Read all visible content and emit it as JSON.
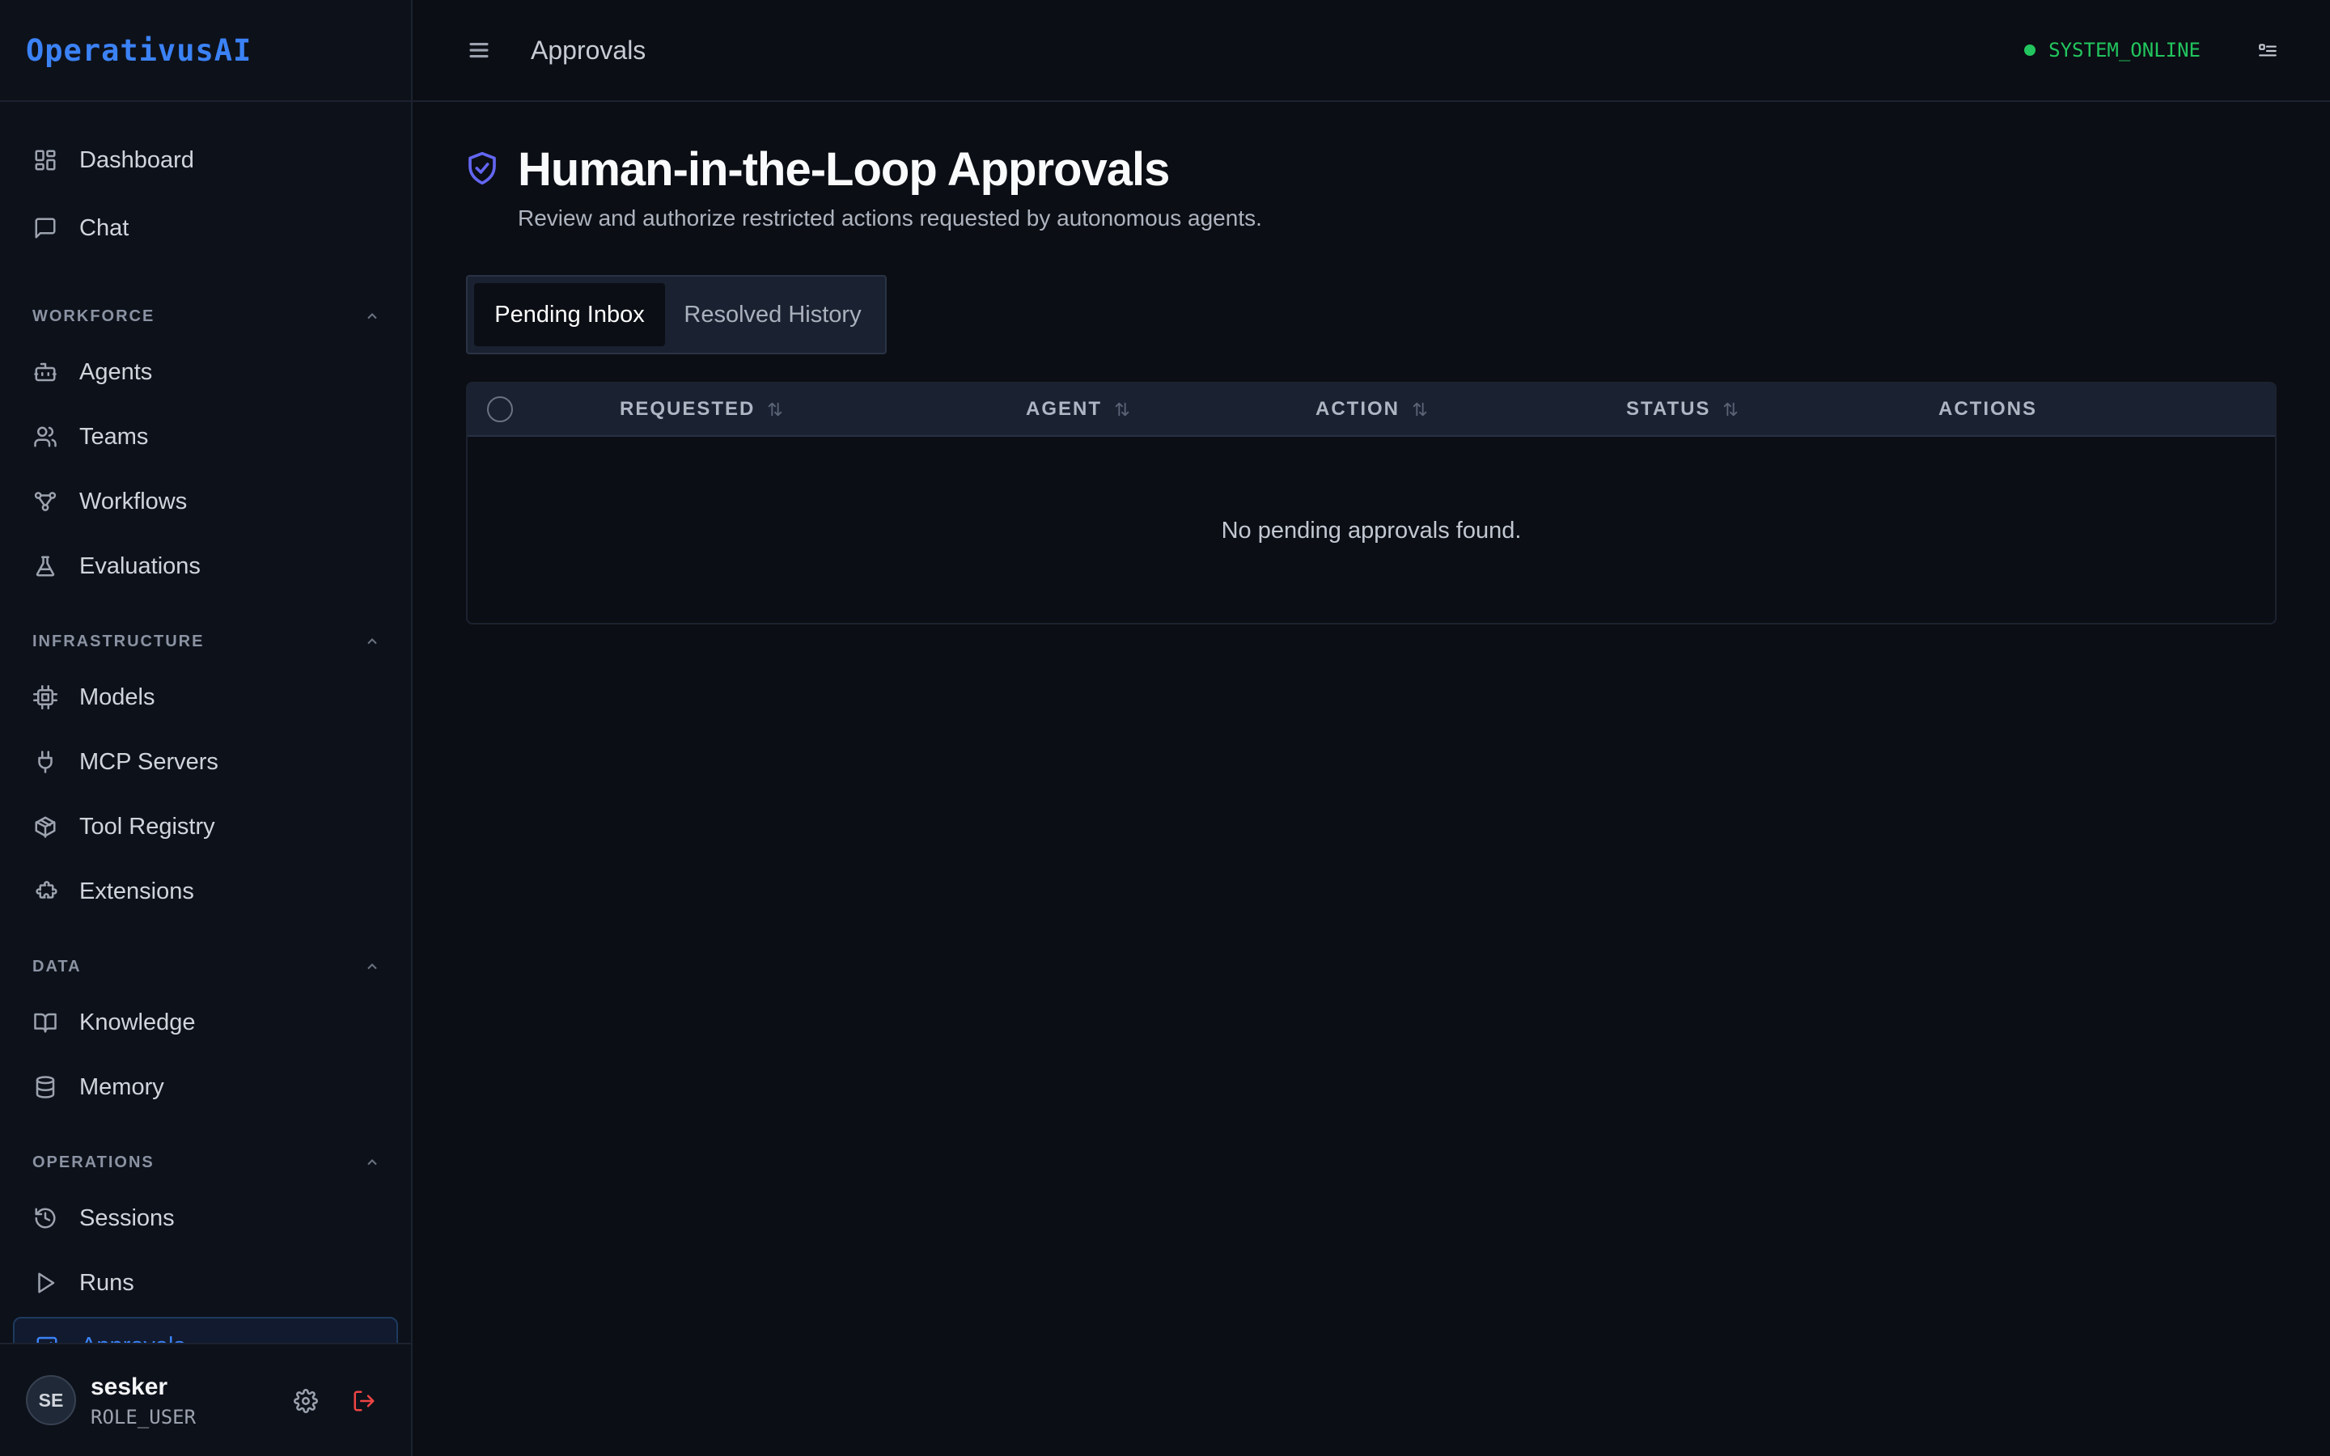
{
  "brand": "OperativusAI",
  "header": {
    "title": "Approvals",
    "status": "SYSTEM_ONLINE"
  },
  "sidebar": {
    "top": [
      {
        "label": "Dashboard"
      },
      {
        "label": "Chat"
      }
    ],
    "sections": [
      {
        "title": "WORKFORCE",
        "items": [
          {
            "label": "Agents"
          },
          {
            "label": "Teams"
          },
          {
            "label": "Workflows"
          },
          {
            "label": "Evaluations"
          }
        ]
      },
      {
        "title": "INFRASTRUCTURE",
        "items": [
          {
            "label": "Models"
          },
          {
            "label": "MCP Servers"
          },
          {
            "label": "Tool Registry"
          },
          {
            "label": "Extensions"
          }
        ]
      },
      {
        "title": "DATA",
        "items": [
          {
            "label": "Knowledge"
          },
          {
            "label": "Memory"
          }
        ]
      },
      {
        "title": "OPERATIONS",
        "items": [
          {
            "label": "Sessions"
          },
          {
            "label": "Runs"
          },
          {
            "label": "Approvals",
            "active": true
          }
        ]
      }
    ]
  },
  "user": {
    "initials": "SE",
    "name": "sesker",
    "role": "ROLE_USER"
  },
  "page": {
    "title": "Human-in-the-Loop Approvals",
    "subtitle": "Review and authorize restricted actions requested by autonomous agents."
  },
  "tabs": [
    {
      "label": "Pending Inbox",
      "active": true
    },
    {
      "label": "Resolved History"
    }
  ],
  "table": {
    "columns": [
      "REQUESTED",
      "AGENT",
      "ACTION",
      "STATUS",
      "ACTIONS"
    ],
    "empty_text": "No pending approvals found."
  },
  "colors": {
    "accent": "#3b82f6",
    "online": "#22c55e",
    "shield": "#6366f1",
    "logout": "#ef4444"
  },
  "icons": [
    "dashboard-icon",
    "chat-icon",
    "bot-icon",
    "users-icon",
    "workflow-icon",
    "flask-icon",
    "cpu-icon",
    "plug-icon",
    "package-icon",
    "puzzle-icon",
    "book-icon",
    "database-icon",
    "history-icon",
    "play-icon",
    "approval-icon",
    "gear-icon",
    "logout-icon",
    "menu-icon",
    "shield-check-icon",
    "list-icon",
    "sort-icon",
    "chevron-up-icon"
  ]
}
